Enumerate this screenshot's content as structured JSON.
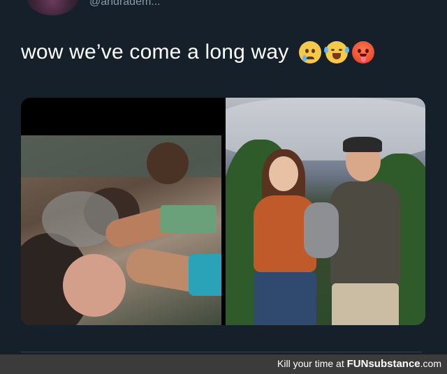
{
  "tweet": {
    "handle": "@andradem..."
  },
  "tweet_text": "wow we’ve come a long way",
  "emojis": [
    "crying-face-icon",
    "tears-of-joy-icon",
    "hot-face-icon"
  ],
  "media": {
    "left_photo": "before-photo",
    "right_photo": "after-photo"
  },
  "watermark": {
    "prefix": "Kill your time at ",
    "brand": "FUNsubstance",
    "suffix": ".com"
  },
  "colors": {
    "background": "#15202b",
    "text": "#ffffff",
    "watermark_bar": "#3b3b3b"
  }
}
